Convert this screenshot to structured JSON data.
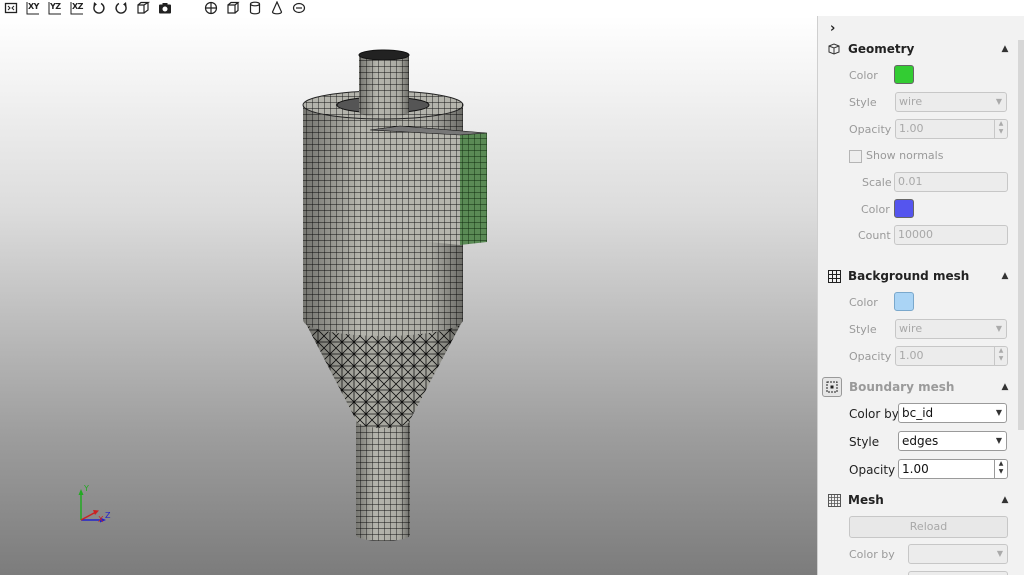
{
  "toolbar": {
    "buttons": [
      {
        "name": "fit-view-icon",
        "label": ""
      },
      {
        "name": "view-xy-button",
        "label": "XY"
      },
      {
        "name": "view-yz-button",
        "label": "YZ"
      },
      {
        "name": "view-xz-button",
        "label": "XZ"
      },
      {
        "name": "rotate-ccw-icon",
        "label": ""
      },
      {
        "name": "rotate-cw-icon",
        "label": ""
      },
      {
        "name": "perspective-icon",
        "label": ""
      },
      {
        "name": "screenshot-icon",
        "label": ""
      },
      {
        "name": "crosshair-icon",
        "label": ""
      },
      {
        "name": "cube-icon",
        "label": ""
      },
      {
        "name": "cylinder-icon",
        "label": ""
      },
      {
        "name": "cone-icon",
        "label": ""
      },
      {
        "name": "ellipse-icon",
        "label": ""
      }
    ]
  },
  "axes": {
    "y": "Y",
    "x": "X",
    "z": "Z"
  },
  "panel": {
    "collapse_glyph": "›",
    "geometry": {
      "title": "Geometry",
      "color_label": "Color",
      "color": "#33cc33",
      "style_label": "Style",
      "style_value": "wire",
      "opacity_label": "Opacity",
      "opacity_value": "1.00",
      "show_normals_label": "Show normals",
      "scale_label": "Scale",
      "scale_value": "0.01",
      "normals_color_label": "Color",
      "normals_color": "#5555ee",
      "count_label": "Count",
      "count_value": "10000"
    },
    "background_mesh": {
      "title": "Background mesh",
      "color_label": "Color",
      "color": "#aad4f5",
      "style_label": "Style",
      "style_value": "wire",
      "opacity_label": "Opacity",
      "opacity_value": "1.00"
    },
    "boundary_mesh": {
      "title": "Boundary mesh",
      "color_by_label": "Color by",
      "color_by_value": "bc_id",
      "style_label": "Style",
      "style_value": "edges",
      "opacity_label": "Opacity",
      "opacity_value": "1.00"
    },
    "mesh": {
      "title": "Mesh",
      "reload_label": "Reload",
      "color_by_label": "Color by",
      "color_by_value": ""
    }
  }
}
